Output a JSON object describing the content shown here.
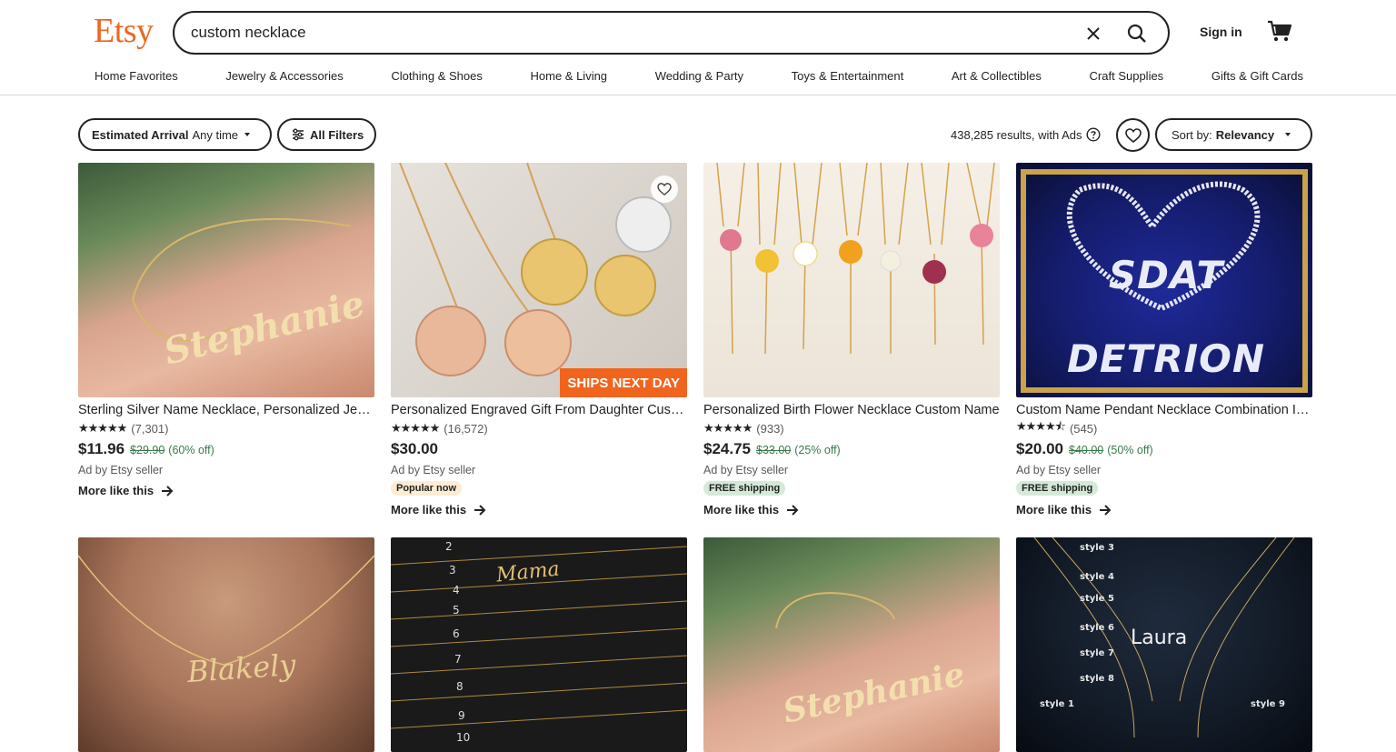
{
  "header": {
    "logo": "Etsy",
    "search_value": "custom necklace",
    "signin_label": "Sign in",
    "categories": [
      "Home Favorites",
      "Jewelry & Accessories",
      "Clothing & Shoes",
      "Home & Living",
      "Wedding & Party",
      "Toys & Entertainment",
      "Art & Collectibles",
      "Craft Supplies",
      "Gifts & Gift Cards"
    ]
  },
  "filters": {
    "arrival_label": "Estimated Arrival",
    "arrival_value": "Any time",
    "all_filters_label": "All Filters",
    "results_text": "438,285 results, with Ads",
    "sort_label": "Sort by:",
    "sort_value": "Relevancy"
  },
  "colors": {
    "brand": "#f1641e",
    "sale_green": "#3a7a4a"
  },
  "products": [
    {
      "title": "Sterling Silver Name Necklace, Personalized Jewelry",
      "stars": "★★★★★",
      "reviews": "(7,301)",
      "price": "$11.96",
      "original": "$29.90",
      "discount": "(60% off)",
      "seller": "Ad by Etsy seller",
      "badge": "",
      "more": "More like this",
      "image_text": "Stephanie"
    },
    {
      "title": "Personalized Engraved Gift From Daughter Custom",
      "stars": "★★★★★",
      "reviews": "(16,572)",
      "price": "$30.00",
      "original": "",
      "discount": "",
      "seller": "Ad by Etsy seller",
      "badge": "Popular now",
      "more": "More like this",
      "image_text": "SHIPS NEXT DAY"
    },
    {
      "title": "Personalized Birth Flower Necklace Custom Name",
      "stars": "★★★★★",
      "reviews": "(933)",
      "price": "$24.75",
      "original": "$33.00",
      "discount": "(25% off)",
      "seller": "Ad by Etsy seller",
      "badge": "FREE shipping",
      "more": "More like this",
      "image_text": ""
    },
    {
      "title": "Custom Name Pendant Necklace Combination Iced",
      "stars": "★★★★⯪",
      "reviews": "(545)",
      "price": "$20.00",
      "original": "$40.00",
      "discount": "(50% off)",
      "seller": "Ad by Etsy seller",
      "badge": "FREE shipping",
      "more": "More like this",
      "image_text": "SDAT DETRION"
    }
  ],
  "row2_images": [
    "Blakely",
    "Mama",
    "Stephanie",
    "Laura"
  ]
}
